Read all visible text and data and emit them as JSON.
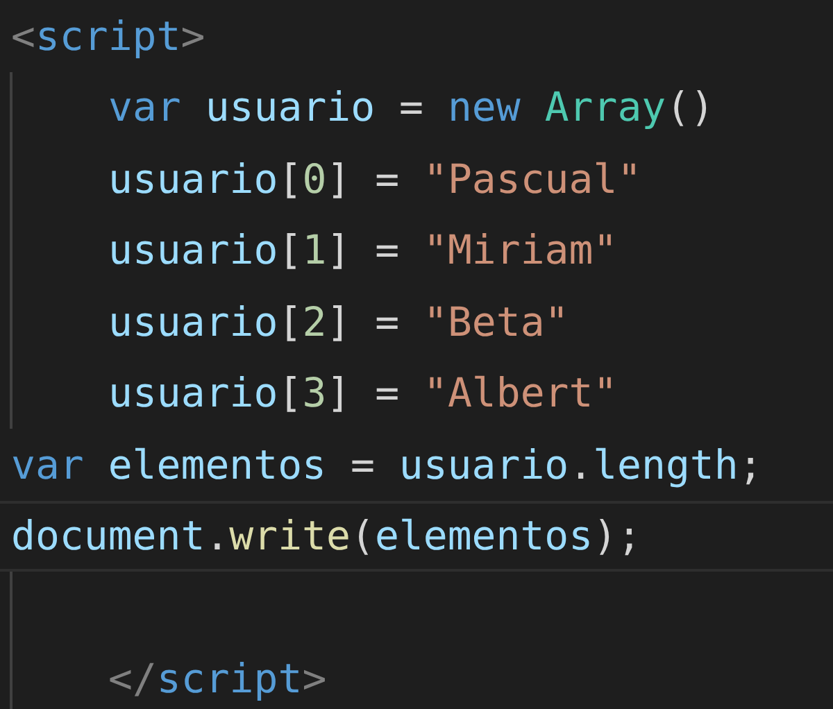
{
  "editor": {
    "lines": [
      {
        "indent": false,
        "guide": false,
        "highlighted": false,
        "tokens": [
          {
            "text": "<",
            "kind": "tag"
          },
          {
            "text": "script",
            "kind": "tagname"
          },
          {
            "text": ">",
            "kind": "tag"
          }
        ]
      },
      {
        "indent": true,
        "guide": true,
        "highlighted": false,
        "tokens": [
          {
            "text": "var",
            "kind": "keyword"
          },
          {
            "text": " usuario",
            "kind": "variable"
          },
          {
            "text": " = ",
            "kind": "punct"
          },
          {
            "text": "new",
            "kind": "keyword"
          },
          {
            "text": " Array",
            "kind": "type"
          },
          {
            "text": "()",
            "kind": "punct"
          }
        ]
      },
      {
        "indent": true,
        "guide": true,
        "highlighted": false,
        "tokens": [
          {
            "text": "usuario",
            "kind": "variable"
          },
          {
            "text": "[",
            "kind": "punct"
          },
          {
            "text": "0",
            "kind": "number"
          },
          {
            "text": "] = ",
            "kind": "punct"
          },
          {
            "text": "\"Pascual\"",
            "kind": "string"
          }
        ]
      },
      {
        "indent": true,
        "guide": true,
        "highlighted": false,
        "tokens": [
          {
            "text": "usuario",
            "kind": "variable"
          },
          {
            "text": "[",
            "kind": "punct"
          },
          {
            "text": "1",
            "kind": "number"
          },
          {
            "text": "] = ",
            "kind": "punct"
          },
          {
            "text": "\"Miriam\"",
            "kind": "string"
          }
        ]
      },
      {
        "indent": true,
        "guide": true,
        "highlighted": false,
        "tokens": [
          {
            "text": "usuario",
            "kind": "variable"
          },
          {
            "text": "[",
            "kind": "punct"
          },
          {
            "text": "2",
            "kind": "number"
          },
          {
            "text": "] = ",
            "kind": "punct"
          },
          {
            "text": "\"Beta\"",
            "kind": "string"
          }
        ]
      },
      {
        "indent": true,
        "guide": true,
        "highlighted": false,
        "tokens": [
          {
            "text": "usuario",
            "kind": "variable"
          },
          {
            "text": "[",
            "kind": "punct"
          },
          {
            "text": "3",
            "kind": "number"
          },
          {
            "text": "] = ",
            "kind": "punct"
          },
          {
            "text": "\"Albert\"",
            "kind": "string"
          }
        ]
      },
      {
        "indent": false,
        "guide": false,
        "highlighted": false,
        "tokens": [
          {
            "text": "var",
            "kind": "keyword"
          },
          {
            "text": " elementos",
            "kind": "variable"
          },
          {
            "text": " = ",
            "kind": "punct"
          },
          {
            "text": "usuario",
            "kind": "variable"
          },
          {
            "text": ".",
            "kind": "punct"
          },
          {
            "text": "length",
            "kind": "variable"
          },
          {
            "text": ";",
            "kind": "punct"
          }
        ]
      },
      {
        "indent": false,
        "guide": false,
        "highlighted": true,
        "tokens": [
          {
            "text": "document",
            "kind": "variable"
          },
          {
            "text": ".",
            "kind": "punct"
          },
          {
            "text": "write",
            "kind": "function"
          },
          {
            "text": "(",
            "kind": "punct"
          },
          {
            "text": "elementos",
            "kind": "variable"
          },
          {
            "text": ");",
            "kind": "punct"
          }
        ]
      },
      {
        "guide": true,
        "highlighted": false
      },
      {
        "indent": true,
        "guide": true,
        "highlighted": false,
        "tokens": [
          {
            "text": "</",
            "kind": "tag"
          },
          {
            "text": "script",
            "kind": "tagname"
          },
          {
            "text": ">",
            "kind": "tag"
          }
        ]
      }
    ]
  }
}
